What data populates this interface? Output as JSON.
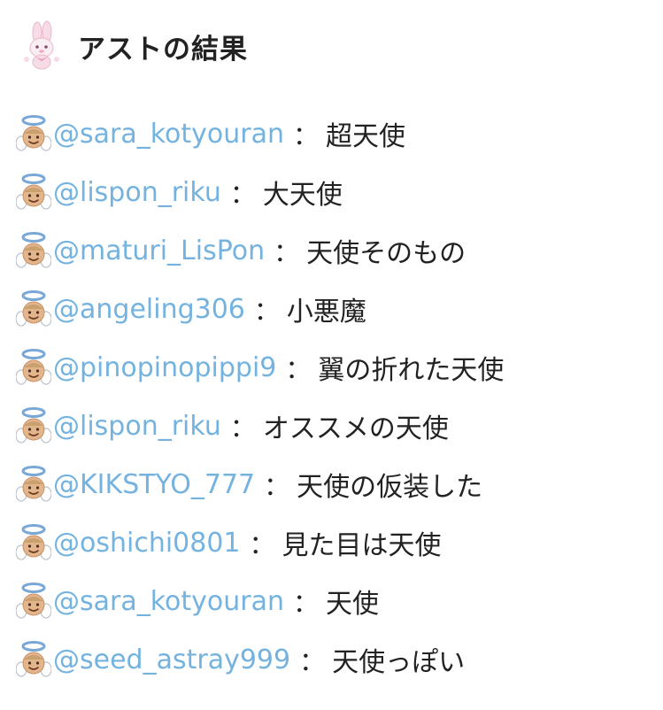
{
  "header": {
    "title": "アストの結果",
    "avatar_icon": "bunny-character-icon"
  },
  "results": [
    {
      "handle": "@sara_kotyouran",
      "separator": "：",
      "result": "超天使",
      "icon": "angel-emoji-icon"
    },
    {
      "handle": "@lispon_riku",
      "separator": "：",
      "result": "大天使",
      "icon": "angel-emoji-icon"
    },
    {
      "handle": "@maturi_LisPon",
      "separator": "：",
      "result": "天使そのもの",
      "icon": "angel-emoji-icon"
    },
    {
      "handle": "@angeling306",
      "separator": "：",
      "result": "小悪魔",
      "icon": "angel-emoji-icon"
    },
    {
      "handle": "@pinopinopippi9",
      "separator": "：",
      "result": "翼の折れた天使",
      "icon": "angel-emoji-icon"
    },
    {
      "handle": "@lispon_riku",
      "separator": "：",
      "result": "オススメの天使",
      "icon": "angel-emoji-icon"
    },
    {
      "handle": "@KIKSTYO_777",
      "separator": "：",
      "result": "天使の仮装した",
      "icon": "angel-emoji-icon"
    },
    {
      "handle": "@oshichi0801",
      "separator": "：",
      "result": "見た目は天使",
      "icon": "angel-emoji-icon"
    },
    {
      "handle": "@sara_kotyouran",
      "separator": "：",
      "result": "天使",
      "icon": "angel-emoji-icon"
    },
    {
      "handle": "@seed_astray999",
      "separator": "：",
      "result": "天使っぽい",
      "icon": "angel-emoji-icon"
    }
  ],
  "colors": {
    "handle_link": "#74b3e0",
    "text": "#222222",
    "background": "#ffffff"
  }
}
